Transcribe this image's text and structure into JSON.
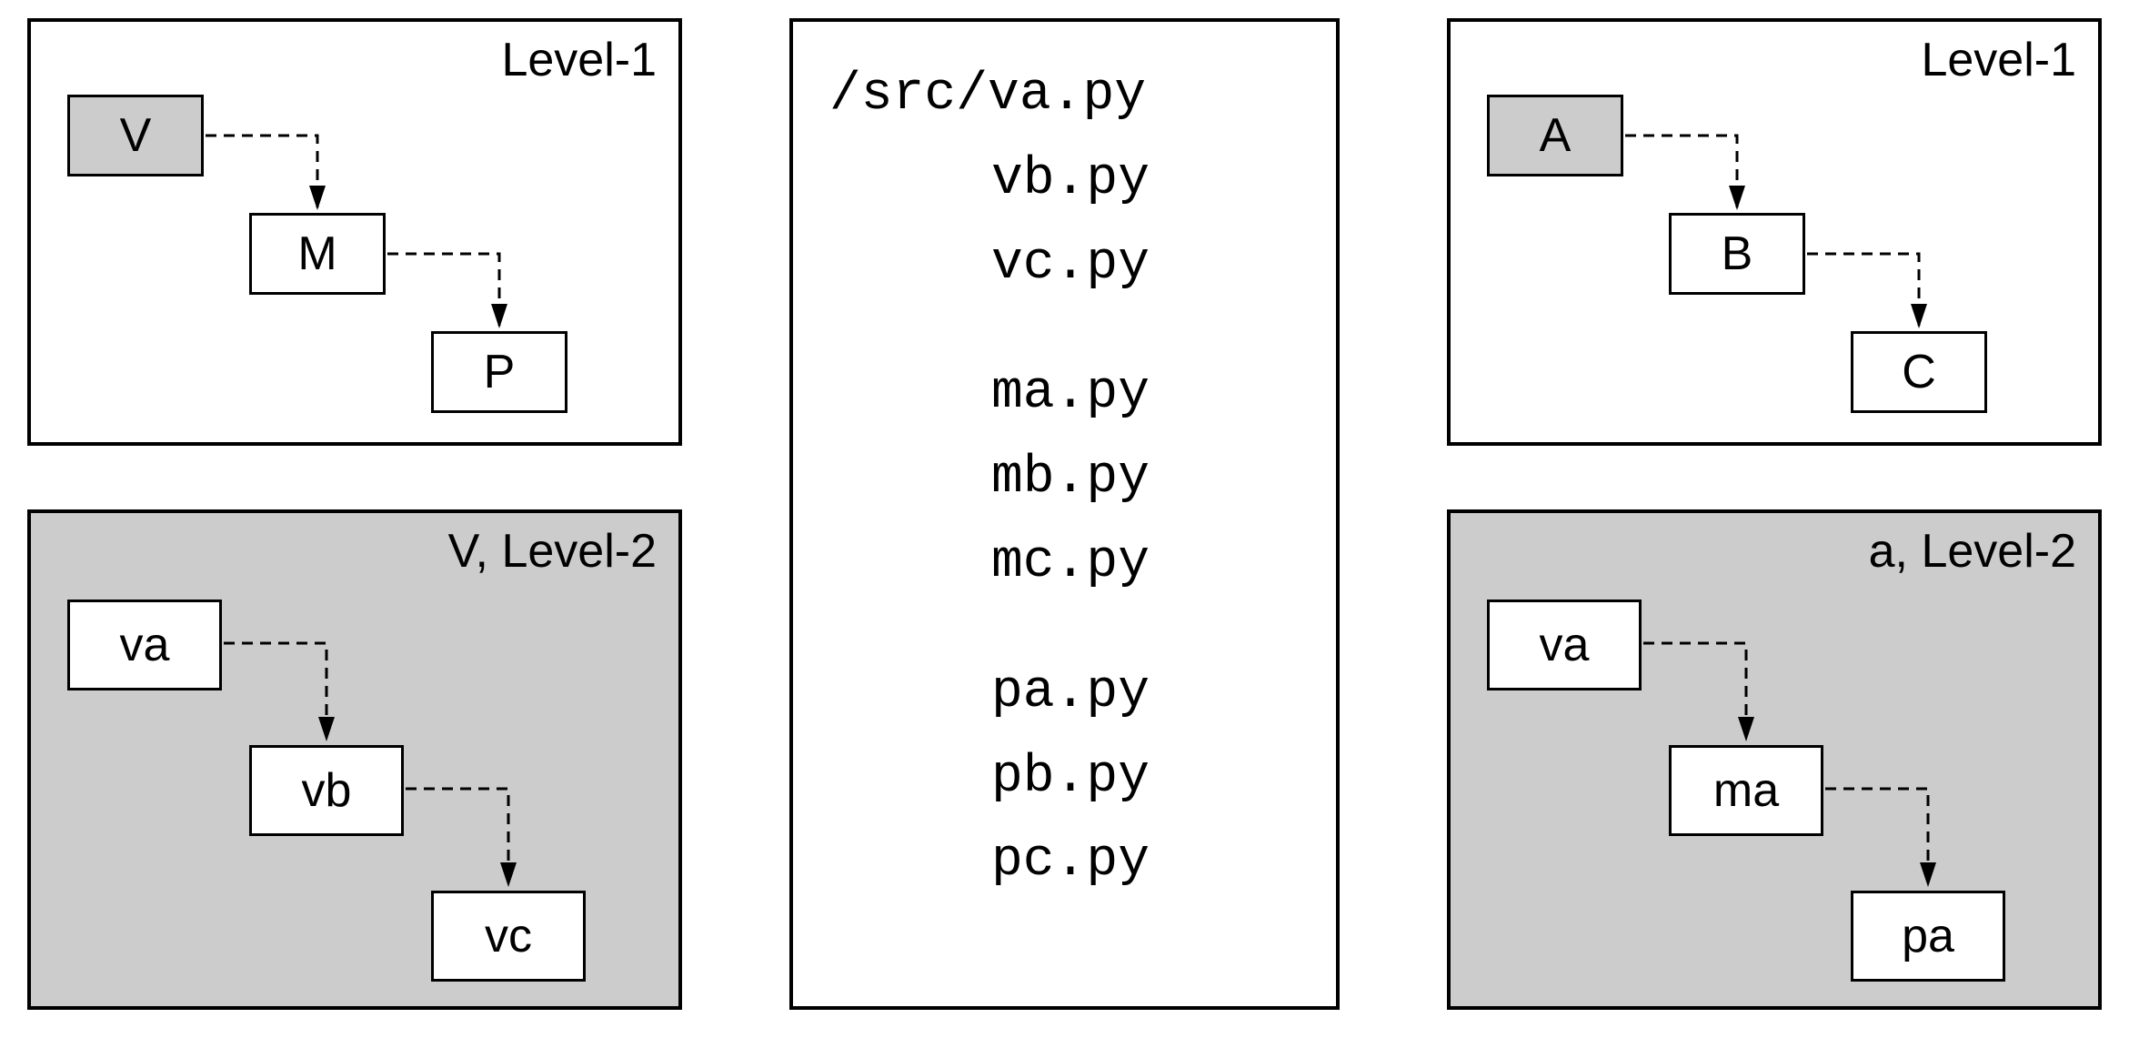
{
  "left": {
    "level1": {
      "title": "Level-1",
      "nodes": {
        "v": "V",
        "m": "M",
        "p": "P"
      }
    },
    "level2": {
      "title": "V, Level-2",
      "nodes": {
        "va": "va",
        "vb": "vb",
        "vc": "vc"
      }
    }
  },
  "center": {
    "dir": "/src/",
    "files": {
      "va": "va.py",
      "vb": "vb.py",
      "vc": "vc.py",
      "ma": "ma.py",
      "mb": "mb.py",
      "mc": "mc.py",
      "pa": "pa.py",
      "pb": "pb.py",
      "pc": "pc.py"
    }
  },
  "right": {
    "level1": {
      "title": "Level-1",
      "nodes": {
        "a": "A",
        "b": "B",
        "c": "C"
      }
    },
    "level2": {
      "title": "a, Level-2",
      "nodes": {
        "va": "va",
        "ma": "ma",
        "pa": "pa"
      }
    }
  }
}
